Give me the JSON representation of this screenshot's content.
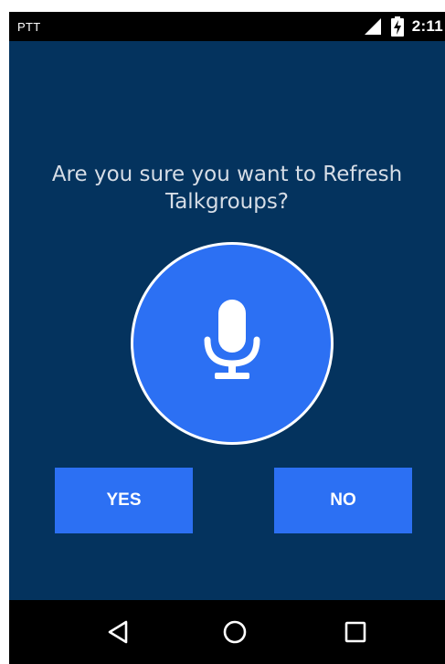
{
  "status_bar": {
    "app_name": "PTT",
    "time": "2:11",
    "signal_icon": "cell-signal-icon",
    "battery_icon": "battery-charging-icon"
  },
  "dialog": {
    "prompt": "Are you sure you want to Refresh Talkgroups?",
    "center_icon": "microphone-icon",
    "yes_label": "YES",
    "no_label": "NO"
  },
  "nav_bar": {
    "back_icon": "back-triangle-icon",
    "home_icon": "home-circle-icon",
    "recents_icon": "recents-square-icon"
  },
  "colors": {
    "background": "#04335e",
    "accent": "#2c70f3",
    "text": "#d6dde6",
    "bars": "#000000"
  }
}
